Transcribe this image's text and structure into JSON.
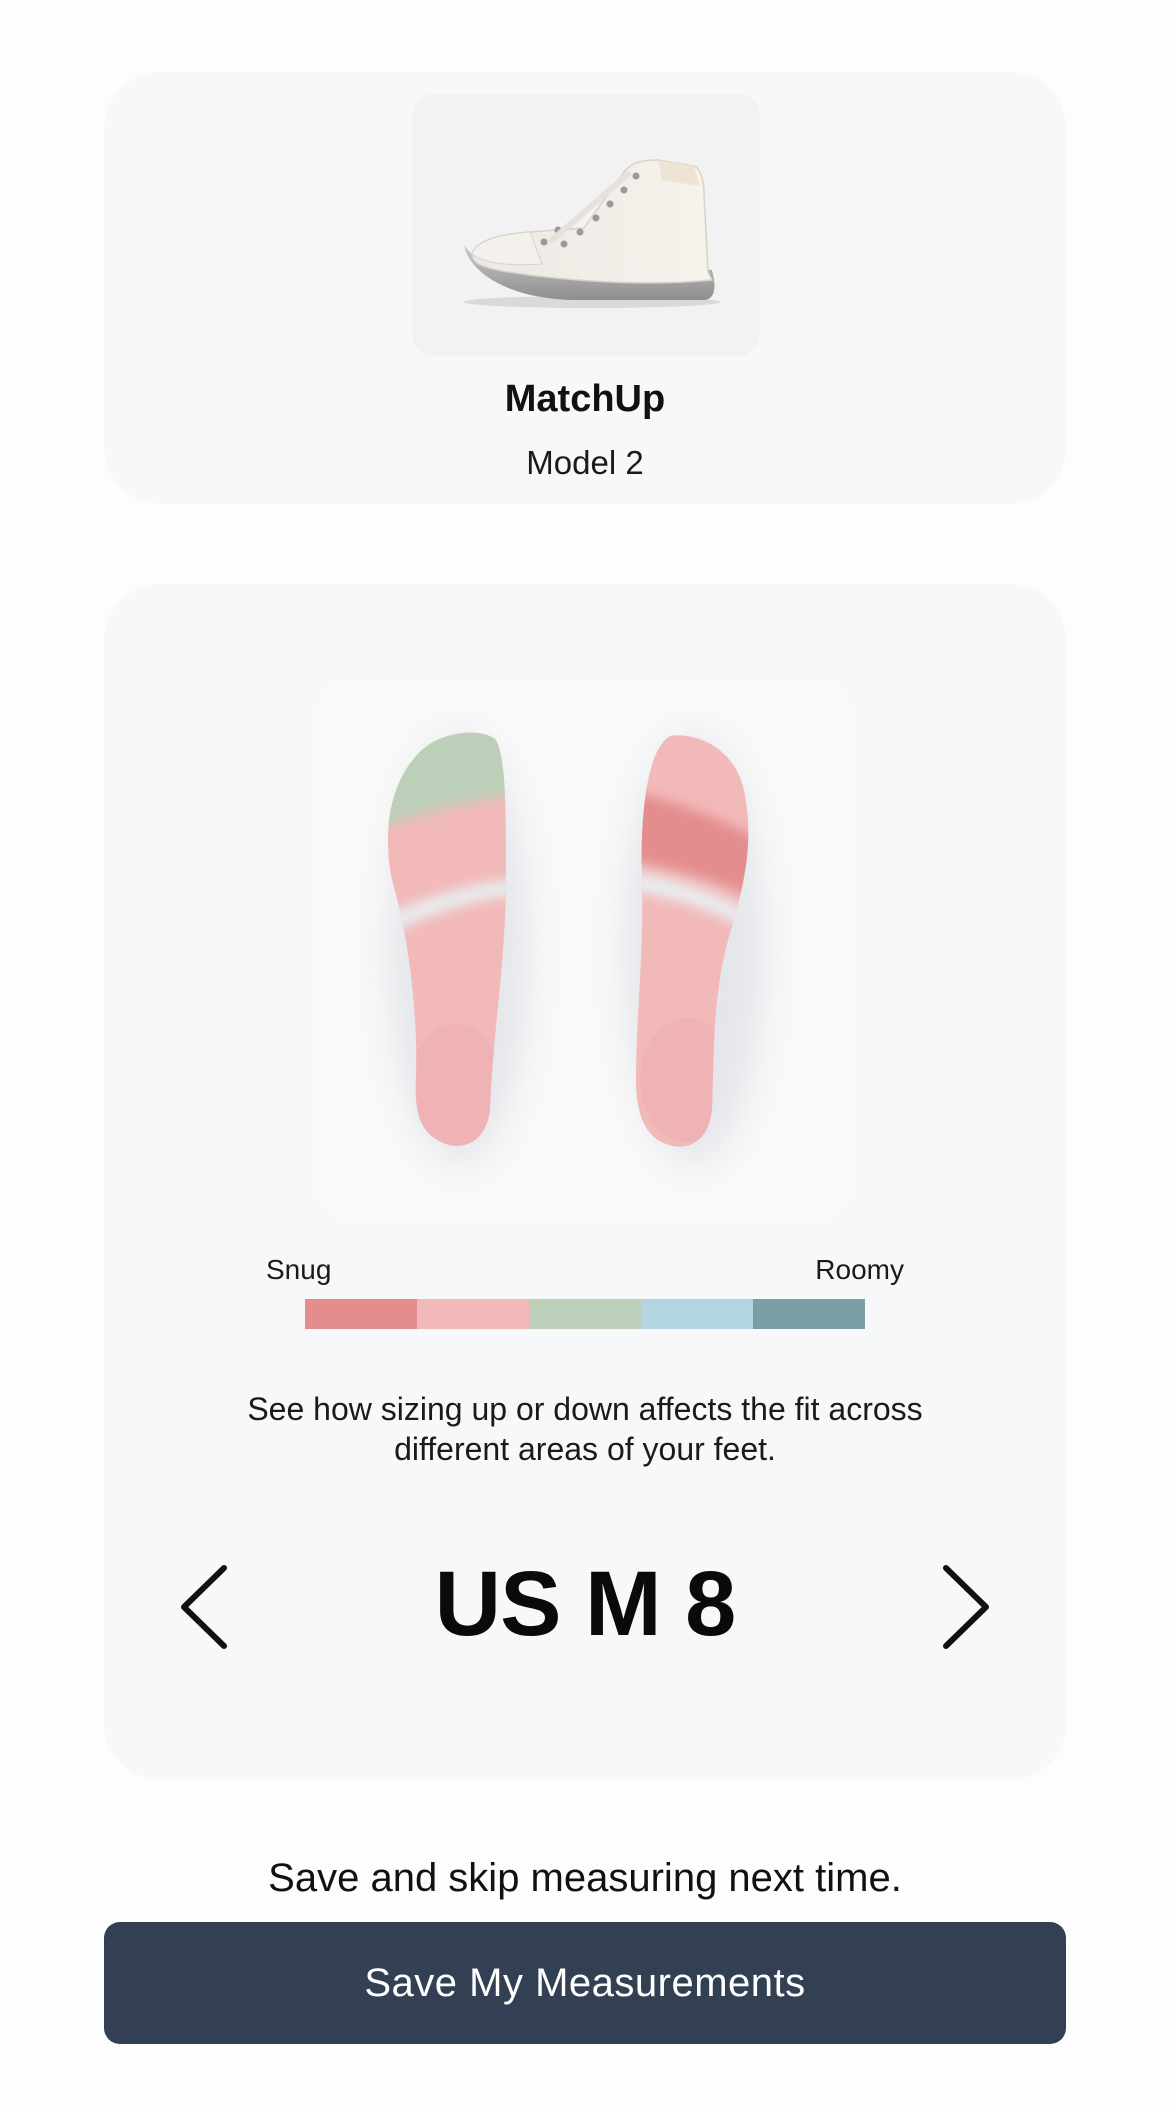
{
  "product": {
    "name": "MatchUp",
    "model": "Model 2",
    "image_icon": "high-top-sneaker-image"
  },
  "fit": {
    "scale": {
      "left_label": "Snug",
      "right_label": "Roomy",
      "colors": [
        "#e38d8d",
        "#f2b9b9",
        "#bccfb8",
        "#b3d5e1",
        "#7c9ea5"
      ]
    },
    "description": "See how sizing up or down affects the fit across different areas of your feet.",
    "size_label": "US M 8",
    "prev_icon": "chevron-left-icon",
    "next_icon": "chevron-right-icon"
  },
  "footer": {
    "hint": "Save and skip measuring next time.",
    "button_label": "Save My Measurements"
  }
}
